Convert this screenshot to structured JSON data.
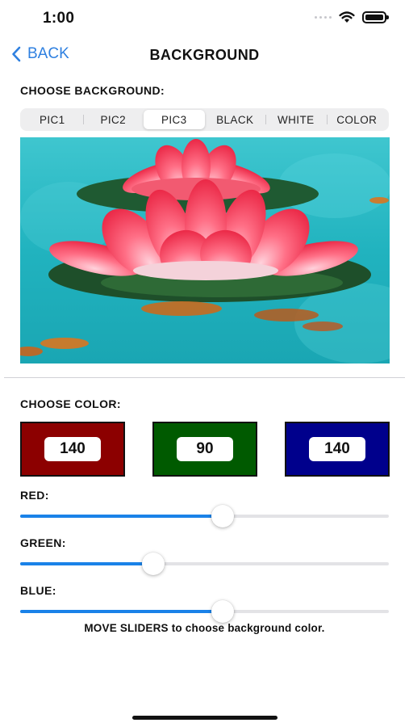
{
  "status_bar": {
    "time": "1:00",
    "icons": [
      "cellular-signal-icon",
      "wifi-icon",
      "battery-icon"
    ]
  },
  "nav": {
    "back_label": "BACK",
    "back_icon": "chevron-left-icon",
    "title": "BACKGROUND",
    "accent_color": "#2f80e0"
  },
  "background_section": {
    "label": "CHOOSE BACKGROUND:",
    "segments": [
      "PIC1",
      "PIC2",
      "PIC3",
      "BLACK",
      "WHITE",
      "COLOR"
    ],
    "selected": "PIC3",
    "picture_subject": "red lotus flowers on turquoise water"
  },
  "color_section": {
    "label": "CHOOSE COLOR:",
    "red": {
      "value": "140",
      "swatch_color": "#8c0000"
    },
    "green": {
      "value": "90",
      "swatch_color": "#005a00"
    },
    "blue": {
      "value": "140",
      "swatch_color": "#00008c"
    }
  },
  "sliders": {
    "red": {
      "label": "RED:",
      "fraction": 0.55
    },
    "green": {
      "label": "GREEN:",
      "fraction": 0.36
    },
    "blue": {
      "label": "BLUE:",
      "fraction": 0.55
    },
    "tint_color": "#1a82e8"
  },
  "hint": "MOVE SLIDERS to choose background color."
}
